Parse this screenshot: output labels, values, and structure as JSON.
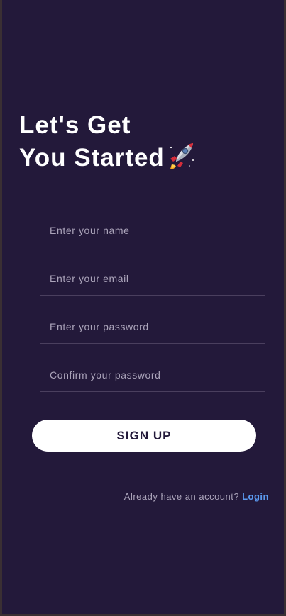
{
  "heading": {
    "line1": "Let's Get",
    "line2": "You Started",
    "emoji_icon": "rocket-icon"
  },
  "form": {
    "name_placeholder": "Enter your name",
    "email_placeholder": "Enter your email",
    "password_placeholder": "Enter your password",
    "confirm_placeholder": "Confirm your password",
    "submit_label": "SIGN UP"
  },
  "footer": {
    "prompt": "Already have an account?",
    "login_label": "Login"
  },
  "colors": {
    "background": "#23193a",
    "text": "#ffffff",
    "link": "#5b9af0",
    "button_bg": "#ffffff"
  }
}
